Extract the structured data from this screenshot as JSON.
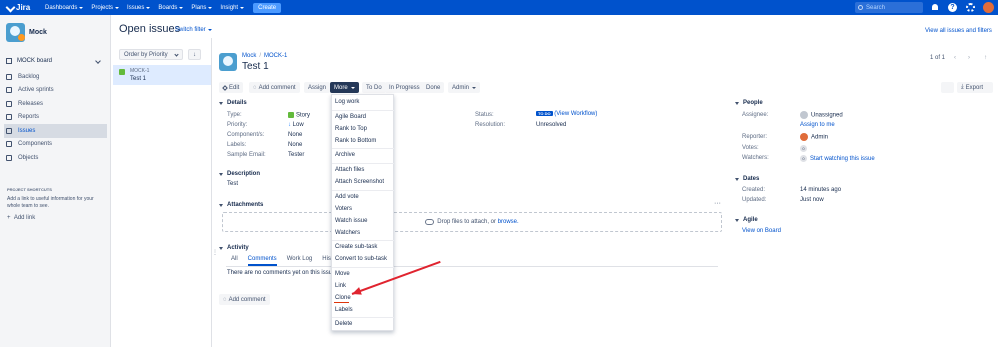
{
  "topnav": {
    "logo": "Jira",
    "items": [
      "Dashboards",
      "Projects",
      "Issues",
      "Boards",
      "Plans",
      "Insight"
    ],
    "create": "Create",
    "search_placeholder": "Search"
  },
  "sidebar": {
    "project_name": "Mock",
    "board": "MOCK board",
    "items": [
      {
        "label": "Backlog"
      },
      {
        "label": "Active sprints"
      },
      {
        "label": "Releases"
      },
      {
        "label": "Reports"
      },
      {
        "label": "Issues"
      },
      {
        "label": "Components"
      },
      {
        "label": "Objects"
      }
    ],
    "shortcuts_title": "PROJECT SHORTCUTS",
    "shortcuts_text": "Add a link to useful information for your whole team to see.",
    "add_link": "Add link"
  },
  "page": {
    "title": "Open issues",
    "switch_filter": "Switch filter",
    "view_all": "View all issues and filters",
    "order_by": "Order by Priority",
    "sort_icon": "↓"
  },
  "list": {
    "key": "MOCK-1",
    "summary": "Test 1"
  },
  "issue": {
    "breadcrumb_project": "Mock",
    "breadcrumb_key": "MOCK-1",
    "title": "Test 1",
    "pager": "1 of 1"
  },
  "toolbar": {
    "edit": "Edit",
    "add_comment": "Add comment",
    "assign": "Assign",
    "more": "More",
    "todo": "To Do",
    "in_progress": "In Progress",
    "done": "Done",
    "admin": "Admin",
    "export": "Export"
  },
  "more_menu": {
    "log_work": "Log work",
    "agile_board": "Agile Board",
    "rank_top": "Rank to Top",
    "rank_bottom": "Rank to Bottom",
    "archive": "Archive",
    "attach_files": "Attach files",
    "attach_screenshot": "Attach Screenshot",
    "add_vote": "Add vote",
    "voters": "Voters",
    "watch_issue": "Watch issue",
    "watchers": "Watchers",
    "create_subtask": "Create sub-task",
    "convert_subtask": "Convert to sub-task",
    "move": "Move",
    "link": "Link",
    "clone": "Clone",
    "labels": "Labels",
    "delete": "Delete"
  },
  "details": {
    "heading": "Details",
    "type_label": "Type:",
    "type_value": "Story",
    "priority_label": "Priority:",
    "priority_value": "Low",
    "components_label": "Component/s:",
    "components_value": "None",
    "labels_label": "Labels:",
    "labels_value": "None",
    "sample_label": "Sample Email:",
    "sample_value": "Tester",
    "status_label": "Status:",
    "status_badge": "TO DO",
    "status_link": "View Workflow",
    "resolution_label": "Resolution:",
    "resolution_value": "Unresolved"
  },
  "description": {
    "heading": "Description",
    "text": "Test"
  },
  "attachments": {
    "heading": "Attachments",
    "drop_text": "Drop files to attach, or",
    "browse": "browse."
  },
  "activity": {
    "heading": "Activity",
    "tabs": [
      "All",
      "Comments",
      "Work Log",
      "History"
    ],
    "empty": "There are no comments yet on this issue.",
    "add_comment": "Add comment"
  },
  "people": {
    "heading": "People",
    "assignee_label": "Assignee:",
    "assignee_value": "Unassigned",
    "assign_to_me": "Assign to me",
    "reporter_label": "Reporter:",
    "reporter_value": "Admin",
    "votes_label": "Votes:",
    "votes_value": "0",
    "watchers_label": "Watchers:",
    "watchers_value": "0",
    "watch_link": "Start watching this issue"
  },
  "dates": {
    "heading": "Dates",
    "created_label": "Created:",
    "created_value": "14 minutes ago",
    "updated_label": "Updated:",
    "updated_value": "Just now"
  },
  "agile": {
    "heading": "Agile",
    "view_on_board": "View on Board"
  },
  "colors": {
    "brand": "#0052cc",
    "annotation": "#e0242f"
  }
}
